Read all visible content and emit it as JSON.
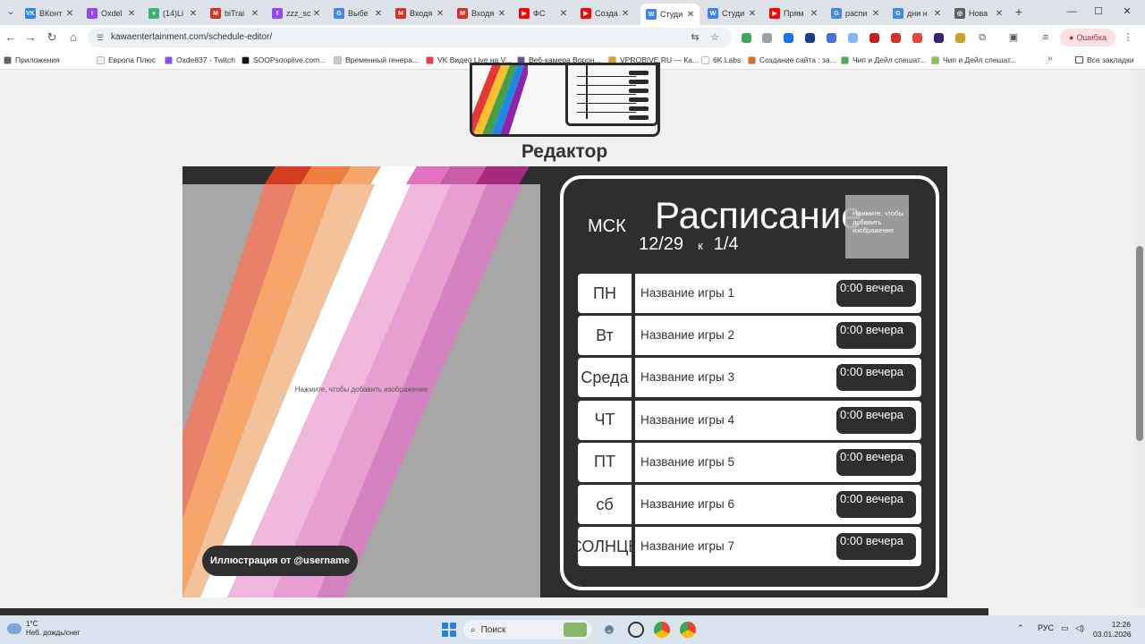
{
  "browser": {
    "tabs": [
      {
        "label": "ВКонт",
        "favicon_color": "#2787f5",
        "favicon_text": "VK"
      },
      {
        "label": "Oxdel",
        "favicon_color": "#9146ff",
        "favicon_text": "t"
      },
      {
        "label": "(14)Li",
        "favicon_color": "#3cb371",
        "favicon_text": "♦"
      },
      {
        "label": "biTrai",
        "favicon_color": "#d93025",
        "favicon_text": "M"
      },
      {
        "label": "zzz_sc",
        "favicon_color": "#9146ff",
        "favicon_text": "t"
      },
      {
        "label": "Выбе",
        "favicon_color": "#4285f4",
        "favicon_text": "G"
      },
      {
        "label": "Входя",
        "favicon_color": "#d93025",
        "favicon_text": "M"
      },
      {
        "label": "Входя",
        "favicon_color": "#d93025",
        "favicon_text": "M"
      },
      {
        "label": "ФС",
        "favicon_color": "#ff0000",
        "favicon_text": "▶"
      },
      {
        "label": "Созда",
        "favicon_color": "#ff0000",
        "favicon_text": "▶"
      },
      {
        "label": "Студи",
        "favicon_color": "#3b82f6",
        "favicon_text": "W",
        "active": true
      },
      {
        "label": "Студи",
        "favicon_color": "#3b82f6",
        "favicon_text": "W"
      },
      {
        "label": "Прям",
        "favicon_color": "#ff0000",
        "favicon_text": "▶"
      },
      {
        "label": "распи",
        "favicon_color": "#4285f4",
        "favicon_text": "G"
      },
      {
        "label": "дни н",
        "favicon_color": "#4285f4",
        "favicon_text": "G"
      },
      {
        "label": "Нова",
        "favicon_color": "#5f6368",
        "favicon_text": "◎"
      }
    ],
    "url": "kawaentertainment.com/schedule-editor/",
    "error_chip": "Ошибка",
    "bookmarks": [
      {
        "label": "Приложения",
        "color": "#5f6368"
      },
      {
        "label": "Европа Плюс",
        "color": "#f0f0f0"
      },
      {
        "label": "Oxde837 - Twitch",
        "color": "#9146ff"
      },
      {
        "label": "SOOPsooplive.com...",
        "color": "#111111"
      },
      {
        "label": "Временный генера...",
        "color": "#cccccc"
      },
      {
        "label": "VK Видео Live на V...",
        "color": "#ff3347"
      },
      {
        "label": "Веб-камера Ворон...",
        "color": "#6a4c93"
      },
      {
        "label": "VPROBIVE.RU — Ка...",
        "color": "#e0a020"
      },
      {
        "label": "6K Labs",
        "color": "#ffffff"
      },
      {
        "label": "Создание сайта : за...",
        "color": "#e07020"
      },
      {
        "label": "Чип и Дейл спешат...",
        "color": "#4caf50"
      },
      {
        "label": "Чип и Дейл спешат...",
        "color": "#8bc34a"
      }
    ],
    "all_bookmarks": "Все закладки"
  },
  "page": {
    "title": "Редактор",
    "art_hint": "Нажмите, чтобы добавить изображение",
    "credit": "Иллюстрация от @username",
    "schedule": {
      "timezone": "МСК",
      "heading": "Расписание",
      "date_from": "12/29",
      "date_sep": "к",
      "date_to": "1/4",
      "image_hint": "Нажмите, чтобы добавить изображение",
      "days": [
        {
          "day": "ПН",
          "game": "Название игры 1",
          "time": "0:00 вечера"
        },
        {
          "day": "Вт",
          "game": "Название игры 2",
          "time": "0:00 вечера"
        },
        {
          "day": "Среда",
          "game": "Название игры 3",
          "time": "0:00 вечера"
        },
        {
          "day": "ЧТ",
          "game": "Название игры 4",
          "time": "0:00 вечера"
        },
        {
          "day": "ПТ",
          "game": "Название игры 5",
          "time": "0:00 вечера"
        },
        {
          "day": "сб",
          "game": "Название игры 6",
          "time": "0:00 вечера"
        },
        {
          "day": "СОЛНЦЕ",
          "game": "Название игры 7",
          "time": "0:00 вечера"
        }
      ]
    },
    "colors": {
      "canvas": "#2e2e2e",
      "stripes": [
        "#e8806a",
        "#f6a66b",
        "#f3c29b",
        "#ffffff",
        "#f0b8dc",
        "#e79ed0",
        "#d483c0"
      ]
    }
  },
  "taskbar": {
    "weather_temp": "1°C",
    "weather_desc": "Неб. дождь/снег",
    "search_label": "Поиск",
    "lang": "РУС",
    "time": "12:26",
    "date": "03.01.2026"
  }
}
